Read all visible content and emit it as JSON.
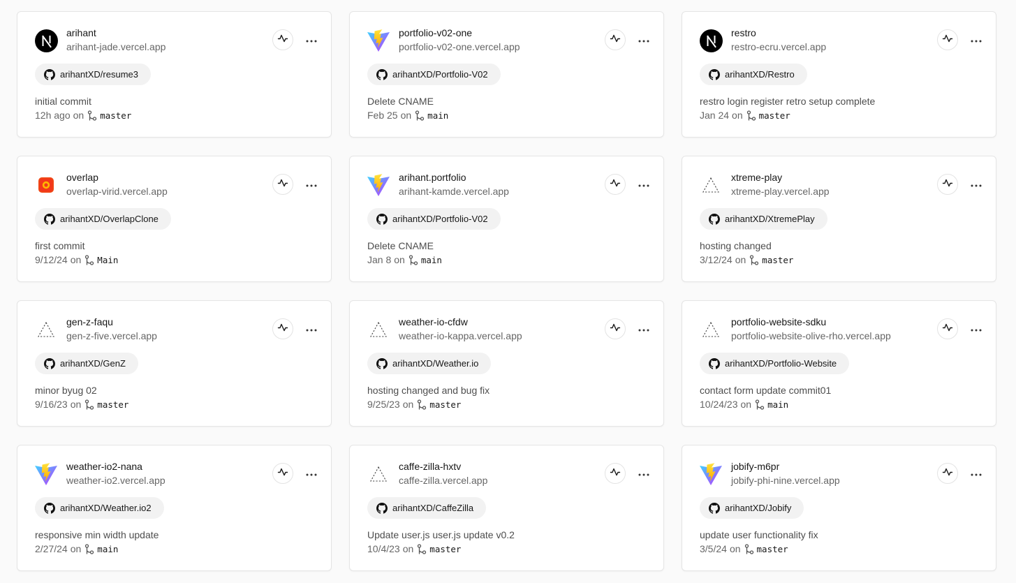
{
  "projects": [
    {
      "name": "arihant",
      "url": "arihant-jade.vercel.app",
      "framework_icon": "nextjs-icon",
      "repo": "arihantXD/resume3",
      "commit_message": "initial commit",
      "time": "12h ago",
      "on": "on",
      "branch": "master"
    },
    {
      "name": "portfolio-v02-one",
      "url": "portfolio-v02-one.vercel.app",
      "framework_icon": "vite-icon",
      "repo": "arihantXD/Portfolio-V02",
      "commit_message": "Delete CNAME",
      "time": "Feb 25",
      "on": "on",
      "branch": "main"
    },
    {
      "name": "restro",
      "url": "restro-ecru.vercel.app",
      "framework_icon": "nextjs-icon",
      "repo": "arihantXD/Restro",
      "commit_message": "restro login register retro setup complete",
      "time": "Jan 24",
      "on": "on",
      "branch": "master"
    },
    {
      "name": "overlap",
      "url": "overlap-virid.vercel.app",
      "framework_icon": "overlap-app-icon",
      "repo": "arihantXD/OverlapClone",
      "commit_message": "first commit",
      "time": "9/12/24",
      "on": "on",
      "branch": "Main"
    },
    {
      "name": "arihant.portfolio",
      "url": "arihant-kamde.vercel.app",
      "framework_icon": "vite-icon",
      "repo": "arihantXD/Portfolio-V02",
      "commit_message": "Delete CNAME",
      "time": "Jan 8",
      "on": "on",
      "branch": "main"
    },
    {
      "name": "xtreme-play",
      "url": "xtreme-play.vercel.app",
      "framework_icon": "vercel-outline-icon",
      "repo": "arihantXD/XtremePlay",
      "commit_message": "hosting changed",
      "time": "3/12/24",
      "on": "on",
      "branch": "master"
    },
    {
      "name": "gen-z-faqu",
      "url": "gen-z-five.vercel.app",
      "framework_icon": "vercel-outline-icon",
      "repo": "arihantXD/GenZ",
      "commit_message": "minor byug 02",
      "time": "9/16/23",
      "on": "on",
      "branch": "master"
    },
    {
      "name": "weather-io-cfdw",
      "url": "weather-io-kappa.vercel.app",
      "framework_icon": "vercel-outline-icon",
      "repo": "arihantXD/Weather.io",
      "commit_message": "hosting changed and bug fix",
      "time": "9/25/23",
      "on": "on",
      "branch": "master"
    },
    {
      "name": "portfolio-website-sdku",
      "url": "portfolio-website-olive-rho.vercel.app",
      "framework_icon": "vercel-outline-icon",
      "repo": "arihantXD/Portfolio-Website",
      "commit_message": "contact form update commit01",
      "time": "10/24/23",
      "on": "on",
      "branch": "main"
    },
    {
      "name": "weather-io2-nana",
      "url": "weather-io2.vercel.app",
      "framework_icon": "vite-icon",
      "repo": "arihantXD/Weather.io2",
      "commit_message": "responsive min width update",
      "time": "2/27/24",
      "on": "on",
      "branch": "main"
    },
    {
      "name": "caffe-zilla-hxtv",
      "url": "caffe-zilla.vercel.app",
      "framework_icon": "vercel-outline-icon",
      "repo": "arihantXD/CaffeZilla",
      "commit_message": "Update user.js user.js update v0.2",
      "time": "10/4/23",
      "on": "on",
      "branch": "master"
    },
    {
      "name": "jobify-m6pr",
      "url": "jobify-phi-nine.vercel.app",
      "framework_icon": "vite-icon",
      "repo": "arihantXD/Jobify",
      "commit_message": "update user functionality fix",
      "time": "3/5/24",
      "on": "on",
      "branch": "master"
    }
  ],
  "icons": {
    "activity": "activity-pulse-icon",
    "more": "more-horizontal-icon",
    "repo": "github-icon",
    "branch": "git-branch-icon"
  },
  "colors": {
    "background": "#fafafa",
    "card": "#ffffff",
    "border": "#e5e5e5",
    "chip": "#f2f2f2",
    "text_primary": "#171717",
    "text_secondary": "#666666"
  }
}
